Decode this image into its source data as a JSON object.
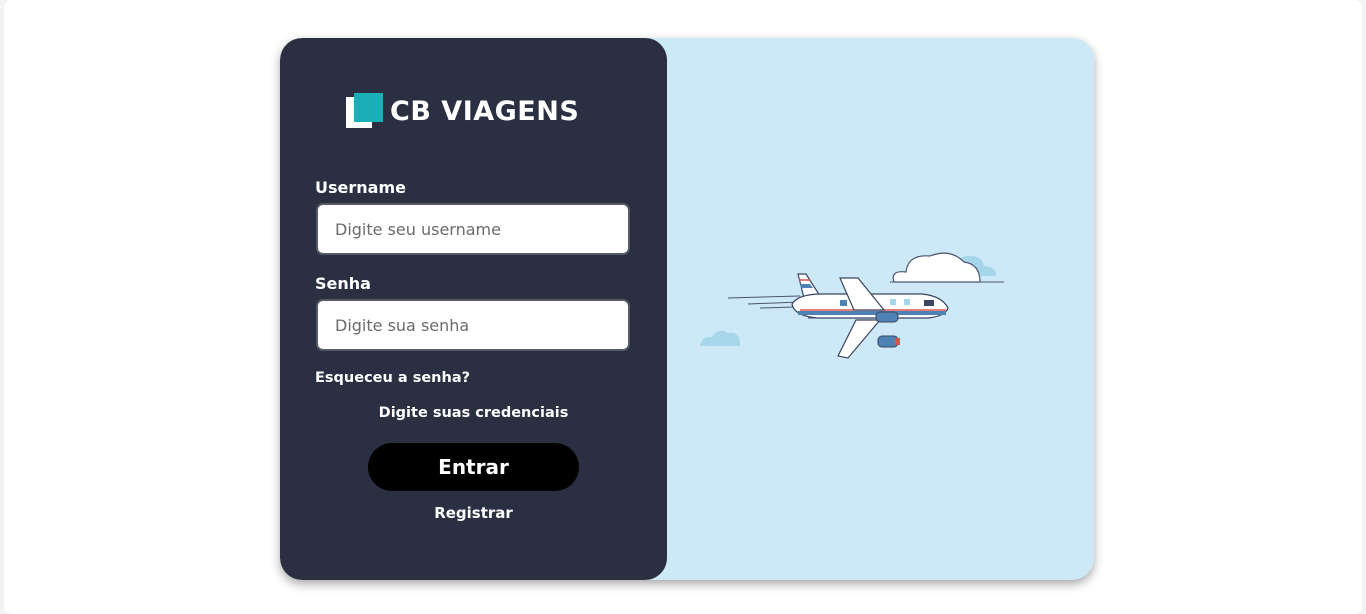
{
  "brand": {
    "name": "CB VIAGENS",
    "colors": {
      "accent": "#1ab0b8",
      "panel": "#2a3042",
      "sky": "#cde9f7"
    }
  },
  "form": {
    "username_label": "Username",
    "username_placeholder": "Digite seu username",
    "password_label": "Senha",
    "password_placeholder": "Digite sua senha",
    "forgot_link": "Esqueceu a senha?",
    "hint": "Digite suas credenciais",
    "submit_label": "Entrar",
    "register_link": "Registrar"
  },
  "illustration": {
    "icon": "airplane-with-clouds-icon"
  }
}
